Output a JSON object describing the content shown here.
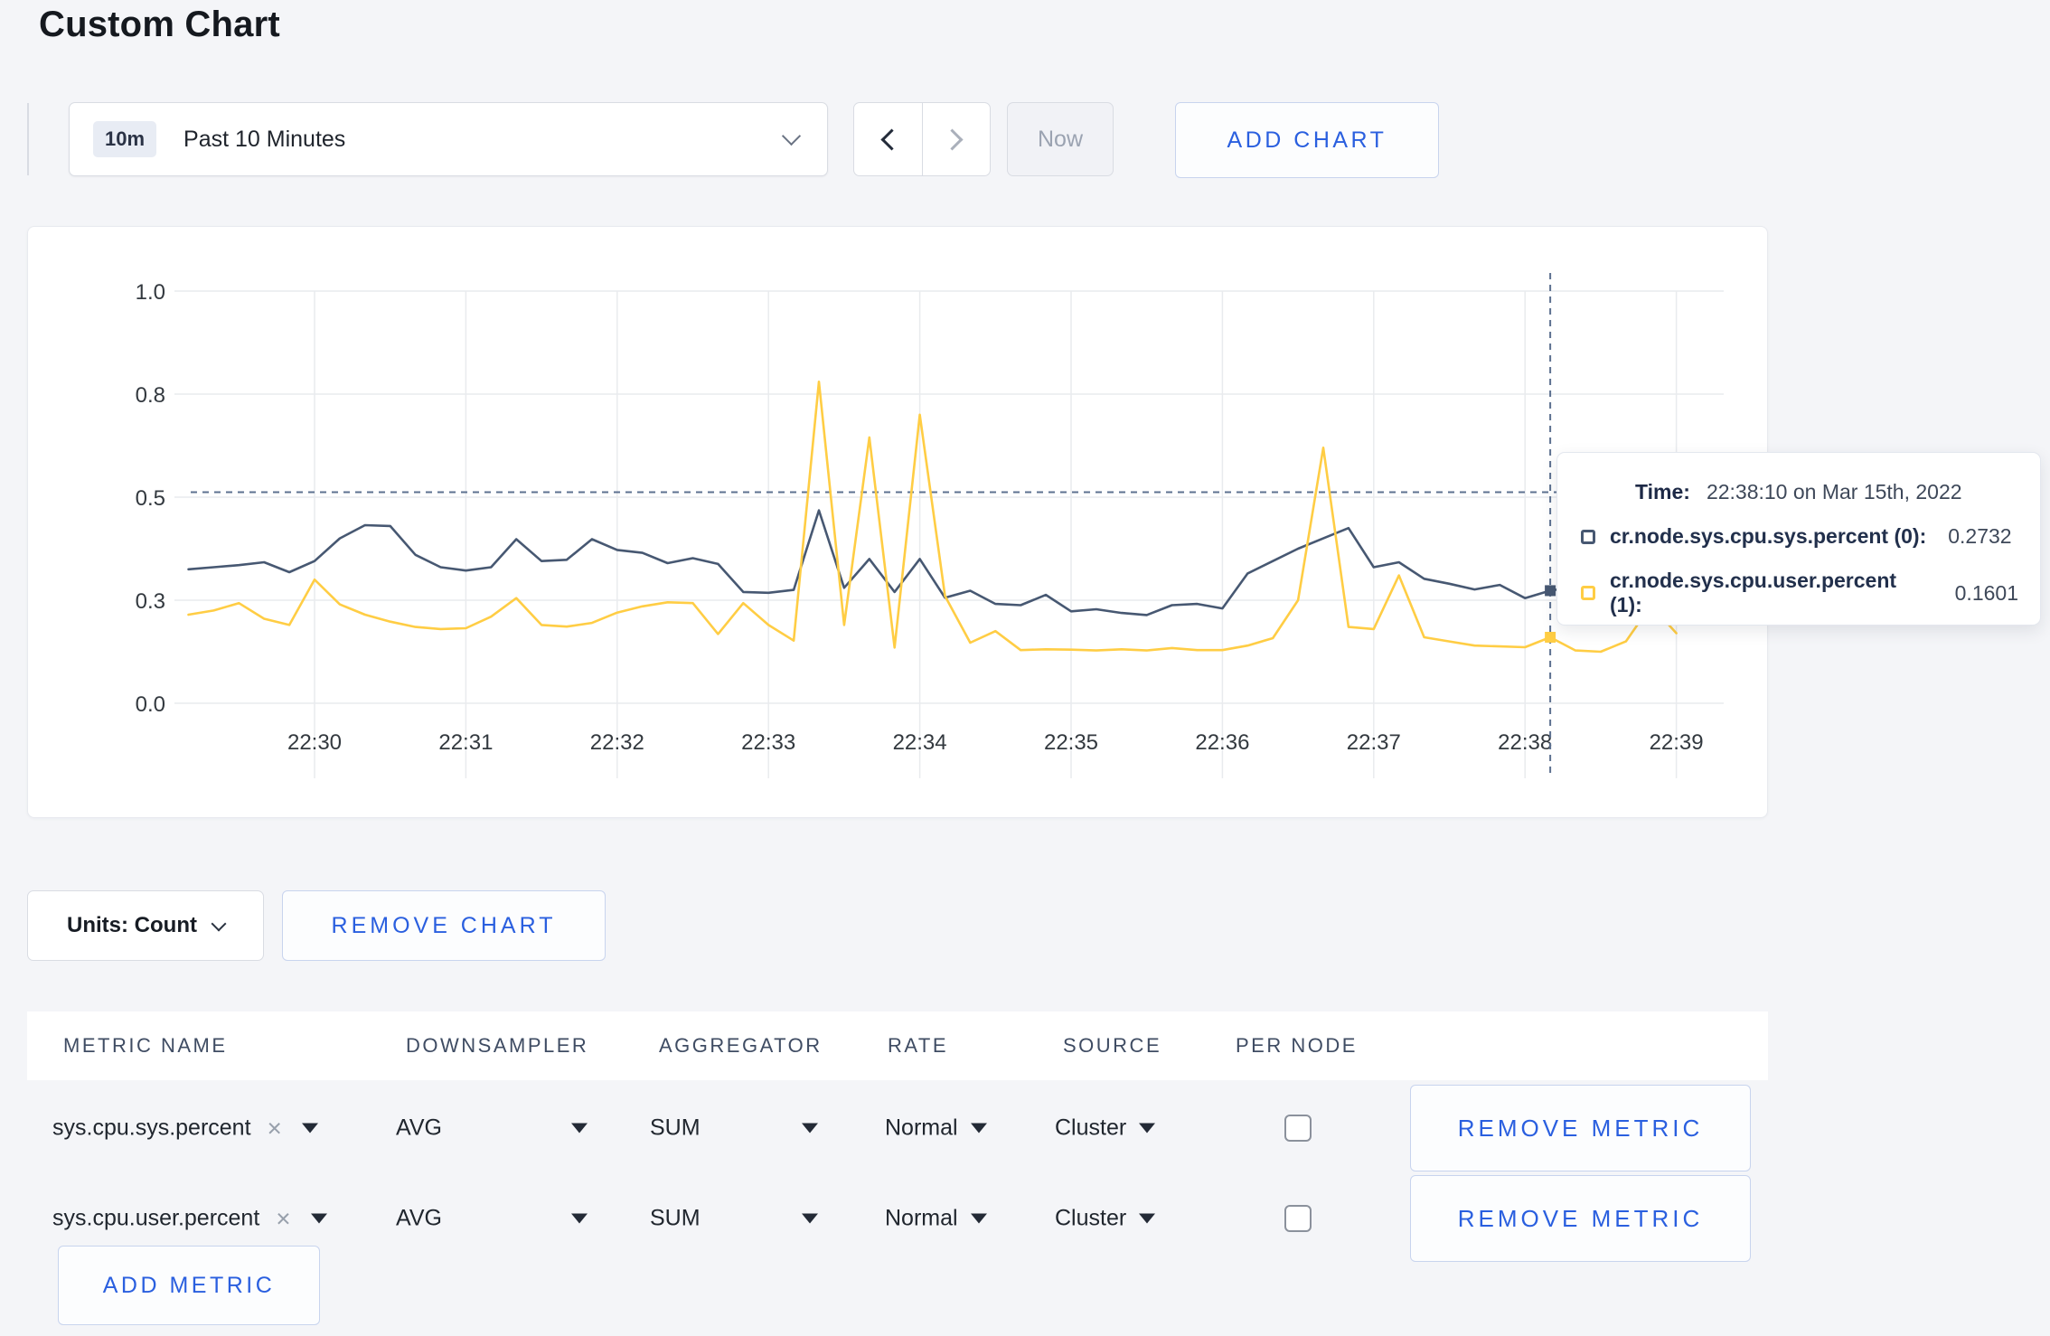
{
  "page": {
    "title": "Custom Chart"
  },
  "colors": {
    "accent_blue": "#2a5fdf",
    "grid": "#e9ebee",
    "crosshair": "#5d7190"
  },
  "toolbar": {
    "time_range": {
      "badge": "10m",
      "label": "Past 10 Minutes"
    },
    "now_label": "Now",
    "add_chart_label": "ADD CHART"
  },
  "tooltip": {
    "time_label": "Time:",
    "time_value": "22:38:10 on Mar 15th, 2022",
    "rows": [
      {
        "label": "cr.node.sys.cpu.sys.percent (0):",
        "value": "0.2732"
      },
      {
        "label": "cr.node.sys.cpu.user.percent (1):",
        "value": "0.1601"
      }
    ]
  },
  "chart_footer": {
    "units_label": "Units: Count",
    "remove_chart_label": "REMOVE CHART"
  },
  "metrics_table": {
    "headers": [
      "METRIC NAME",
      "DOWNSAMPLER",
      "AGGREGATOR",
      "RATE",
      "SOURCE",
      "PER NODE"
    ],
    "rows": [
      {
        "name": "sys.cpu.sys.percent",
        "downsampler": "AVG",
        "aggregator": "SUM",
        "rate": "Normal",
        "source": "Cluster",
        "per_node_checked": false,
        "remove_label": "REMOVE METRIC"
      },
      {
        "name": "sys.cpu.user.percent",
        "downsampler": "AVG",
        "aggregator": "SUM",
        "rate": "Normal",
        "source": "Cluster",
        "per_node_checked": false,
        "remove_label": "REMOVE METRIC"
      }
    ],
    "add_metric_label": "ADD METRIC"
  },
  "chart_data": {
    "type": "line",
    "title": "",
    "xlabel": "",
    "ylabel": "",
    "ylim": [
      0,
      1
    ],
    "grid": true,
    "x_ticks": [
      "22:30",
      "22:31",
      "22:32",
      "22:33",
      "22:34",
      "22:35",
      "22:36",
      "22:37",
      "22:38",
      "22:39"
    ],
    "y_ticks": {
      "values": [
        0,
        0.25,
        0.5,
        0.75,
        1.0
      ],
      "labels": [
        "0.0",
        "0.3",
        "0.5",
        "0.8",
        "1.0"
      ]
    },
    "x_start": "22:29:10",
    "x_interval_sec": 10,
    "series": [
      {
        "name": "cr.node.sys.cpu.sys.percent (0)",
        "color": "#475872",
        "values": [
          0.325,
          0.33,
          0.335,
          0.342,
          0.318,
          0.345,
          0.4,
          0.432,
          0.43,
          0.36,
          0.33,
          0.322,
          0.33,
          0.398,
          0.345,
          0.348,
          0.398,
          0.372,
          0.365,
          0.34,
          0.352,
          0.338,
          0.27,
          0.268,
          0.275,
          0.468,
          0.28,
          0.35,
          0.27,
          0.35,
          0.256,
          0.273,
          0.241,
          0.238,
          0.263,
          0.223,
          0.228,
          0.219,
          0.214,
          0.238,
          0.241,
          0.23,
          0.315,
          0.345,
          0.375,
          0.4,
          0.425,
          0.33,
          0.342,
          0.302,
          0.29,
          0.276,
          0.287,
          0.255,
          0.2732,
          0.282,
          0.287,
          0.29,
          0.292,
          0.3
        ]
      },
      {
        "name": "cr.node.sys.cpu.user.percent (1)",
        "color": "#FFCD44",
        "values": [
          0.215,
          0.225,
          0.243,
          0.205,
          0.19,
          0.3,
          0.24,
          0.215,
          0.198,
          0.185,
          0.18,
          0.182,
          0.21,
          0.255,
          0.19,
          0.186,
          0.195,
          0.22,
          0.235,
          0.245,
          0.243,
          0.168,
          0.243,
          0.19,
          0.152,
          0.78,
          0.19,
          0.645,
          0.135,
          0.7,
          0.26,
          0.147,
          0.175,
          0.129,
          0.131,
          0.13,
          0.128,
          0.131,
          0.128,
          0.134,
          0.129,
          0.129,
          0.14,
          0.158,
          0.25,
          0.62,
          0.185,
          0.18,
          0.31,
          0.16,
          0.15,
          0.14,
          0.138,
          0.136,
          0.1601,
          0.128,
          0.125,
          0.15,
          0.238,
          0.17
        ]
      }
    ],
    "hover": {
      "index": 54,
      "time": "22:38:10 on Mar 15th, 2022",
      "crosshair_value": 0.512,
      "point_values": [
        0.2732,
        0.1601
      ]
    },
    "legend_position": "tooltip"
  }
}
